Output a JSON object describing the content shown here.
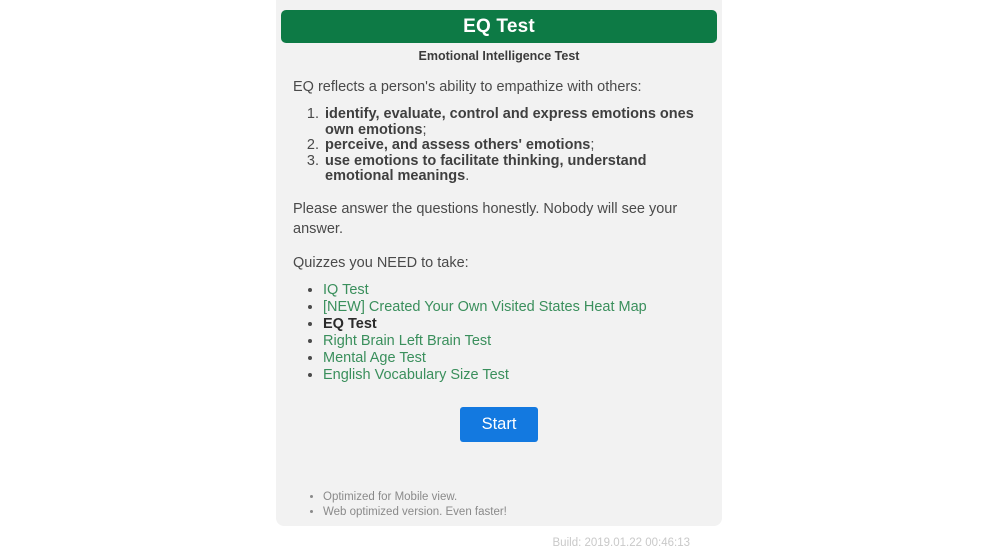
{
  "header": {
    "title": "EQ Test"
  },
  "subtitle": "Emotional Intelligence Test",
  "intro": "EQ reflects a person's ability to empathize with others:",
  "traits": [
    {
      "text": "identify, evaluate, control and express emotions ones own emotions",
      "tail": ";"
    },
    {
      "text": "perceive, and assess others' emotions",
      "tail": ";"
    },
    {
      "text": "use emotions to facilitate thinking, understand emotional meanings",
      "tail": "."
    }
  ],
  "notice": "Please answer the questions honestly. Nobody will see your answer.",
  "quizzes_heading": "Quizzes you NEED to take:",
  "quizzes": [
    {
      "label": "IQ Test",
      "current": false
    },
    {
      "label": "[NEW] Created Your Own Visited States Heat Map",
      "current": false
    },
    {
      "label": "EQ Test",
      "current": true
    },
    {
      "label": "Right Brain Left Brain Test",
      "current": false
    },
    {
      "label": "Mental Age Test",
      "current": false
    },
    {
      "label": "English Vocabulary Size Test",
      "current": false
    }
  ],
  "start_button": "Start",
  "footer_notes": [
    "Optimized for Mobile view.",
    "Web optimized version. Even faster!"
  ],
  "build": "Build: 2019.01.22 00:46:13",
  "colors": {
    "header_green": "#0d7a45",
    "link_green": "#3a8f5c",
    "button_blue": "#1379e0",
    "card_background": "#f2f2f2"
  }
}
